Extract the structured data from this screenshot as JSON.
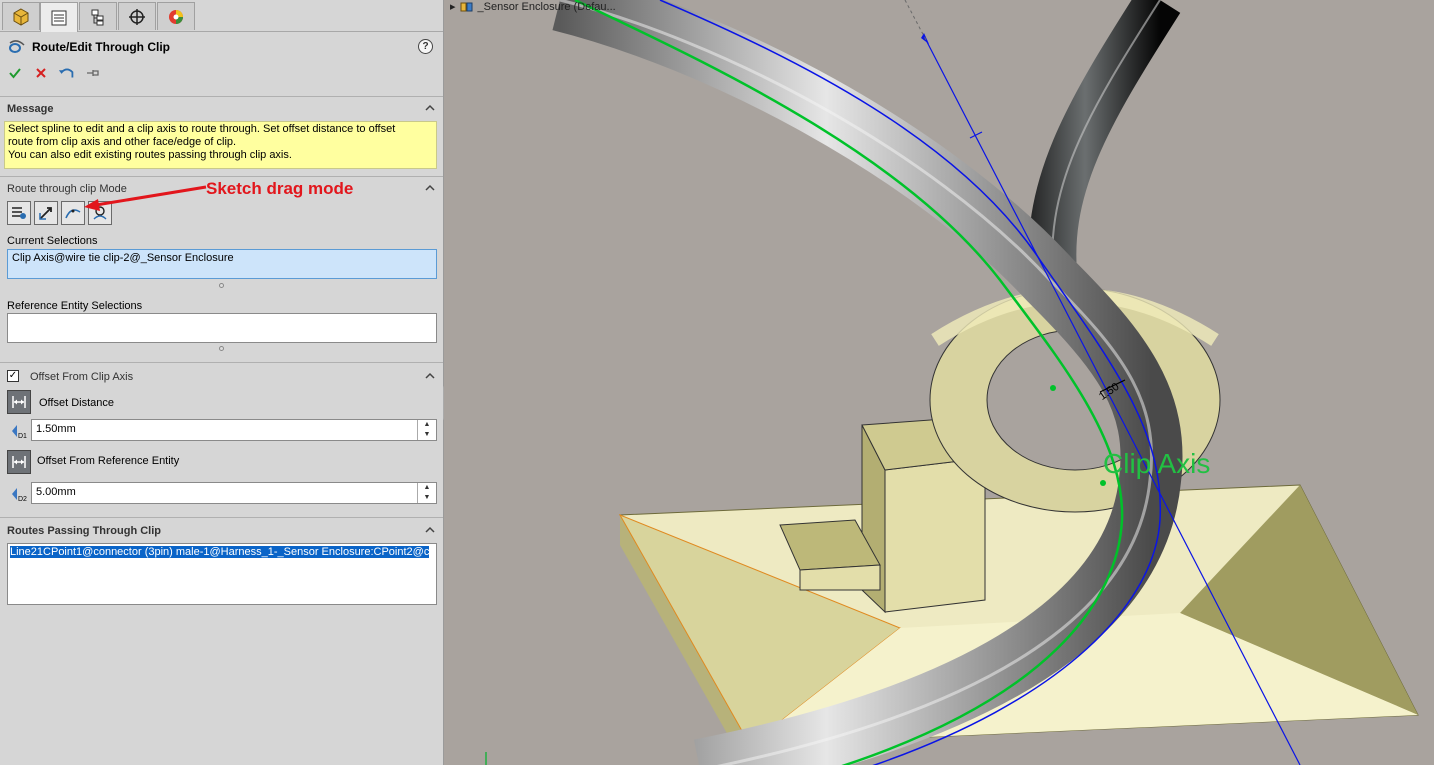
{
  "tabs": [
    {
      "name": "featuremanager",
      "icon": "cube-icon"
    },
    {
      "name": "propertymanager",
      "icon": "property-list-icon",
      "active": true
    },
    {
      "name": "configurationmanager",
      "icon": "config-tree-icon"
    },
    {
      "name": "dimxpert",
      "icon": "crosshair-icon"
    },
    {
      "name": "display",
      "icon": "color-wheel-icon"
    }
  ],
  "pm": {
    "title": "Route/Edit Through Clip",
    "help": "?"
  },
  "message": {
    "header": "Message",
    "text1": "Select spline to edit and a clip axis to route through. Set offset distance to offset",
    "text2": "route from clip axis and other face/edge of clip.",
    "text3": "You can also edit existing routes passing through clip axis."
  },
  "mode": {
    "header": "Route through clip Mode",
    "annotation": "Sketch drag mode"
  },
  "selections": {
    "current_label": "Current Selections",
    "current_value": "Clip Axis@wire tie clip-2@_Sensor Enclosure",
    "reference_label": "Reference Entity Selections",
    "reference_value": ""
  },
  "offset": {
    "header": "Offset From Clip Axis",
    "checked": true,
    "distance_label": "Offset Distance",
    "distance_value": "1.50mm",
    "ref_label": "Offset From Reference Entity",
    "ref_value": "5.00mm",
    "d1": "D1",
    "d2": "D2"
  },
  "routes": {
    "header": "Routes Passing Through Clip",
    "items": [
      "Line21CPoint1@connector (3pin) male-1@Harness_1-_Sensor Enclosure:CPoint2@c"
    ]
  },
  "viewport": {
    "tree_crumb": "_Sensor Enclosure (Defau...",
    "clip_axis_label": "Clip Axis",
    "dimension": "1.50",
    "colors": {
      "background": "#a9a39e",
      "clip": "#e8e4b0",
      "base": "#d9d6a0",
      "wire": "#b8b8b8",
      "spline_green": "#00c22a",
      "axis_blue": "#0a14e6"
    }
  }
}
